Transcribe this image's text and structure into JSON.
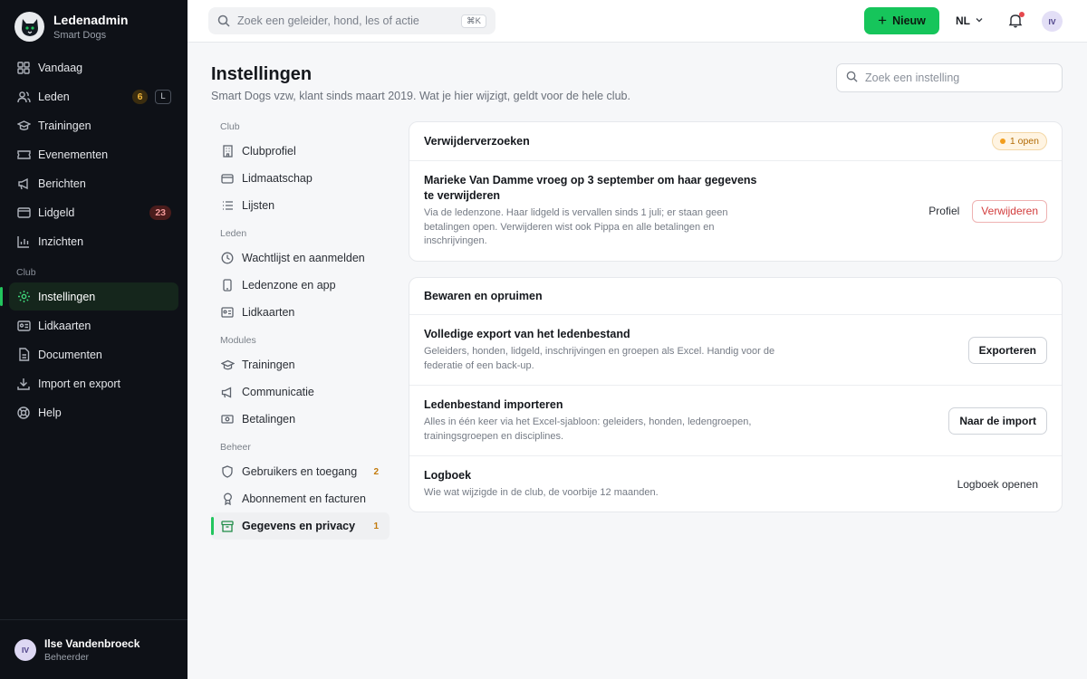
{
  "brand": {
    "title": "Ledenadmin",
    "subtitle": "Smart Dogs"
  },
  "sidebar": {
    "items": [
      {
        "label": "Vandaag",
        "icon": "grid-icon"
      },
      {
        "label": "Leden",
        "icon": "users-icon",
        "badge": "6",
        "shortcut": "L"
      },
      {
        "label": "Trainingen",
        "icon": "graduation-cap-icon"
      },
      {
        "label": "Evenementen",
        "icon": "ticket-icon"
      },
      {
        "label": "Berichten",
        "icon": "megaphone-icon"
      },
      {
        "label": "Lidgeld",
        "icon": "wallet-icon",
        "badge": "23"
      },
      {
        "label": "Inzichten",
        "icon": "bar-chart-icon"
      }
    ],
    "section_club": "Club",
    "club_items": [
      {
        "label": "Instellingen",
        "icon": "gear-icon",
        "active": true
      },
      {
        "label": "Lidkaarten",
        "icon": "id-card-icon"
      },
      {
        "label": "Documenten",
        "icon": "document-icon"
      },
      {
        "label": "Import en export",
        "icon": "download-icon"
      },
      {
        "label": "Help",
        "icon": "lifebuoy-icon"
      }
    ]
  },
  "user": {
    "initials": "IV",
    "name": "Ilse Vandenbroeck",
    "role": "Beheerder"
  },
  "topbar": {
    "search_placeholder": "Zoek een geleider, hond, les of actie",
    "search_shortcut": "⌘K",
    "new_label": "Nieuw",
    "lang": "NL",
    "avatar": "IV"
  },
  "page": {
    "title": "Instellingen",
    "subtitle": "Smart Dogs vzw, klant sinds maart 2019. Wat je hier wijzigt, geldt voor de hele club.",
    "search_placeholder": "Zoek een instelling"
  },
  "settings_nav": {
    "sections": [
      {
        "label": "Club",
        "items": [
          {
            "label": "Clubprofiel",
            "icon": "building-icon"
          },
          {
            "label": "Lidmaatschap",
            "icon": "wallet-icon"
          },
          {
            "label": "Lijsten",
            "icon": "list-icon"
          }
        ]
      },
      {
        "label": "Leden",
        "items": [
          {
            "label": "Wachtlijst en aanmelden",
            "icon": "clock-icon"
          },
          {
            "label": "Ledenzone en app",
            "icon": "phone-icon"
          },
          {
            "label": "Lidkaarten",
            "icon": "id-card-icon"
          }
        ]
      },
      {
        "label": "Modules",
        "items": [
          {
            "label": "Trainingen",
            "icon": "graduation-cap-icon"
          },
          {
            "label": "Communicatie",
            "icon": "megaphone-icon"
          },
          {
            "label": "Betalingen",
            "icon": "cash-icon"
          }
        ]
      },
      {
        "label": "Beheer",
        "items": [
          {
            "label": "Gebruikers en toegang",
            "icon": "shield-icon",
            "badge": "2"
          },
          {
            "label": "Abonnement en facturen",
            "icon": "award-icon"
          },
          {
            "label": "Gegevens en privacy",
            "icon": "archive-icon",
            "badge": "1",
            "active": true
          }
        ]
      }
    ]
  },
  "deletion_card": {
    "title": "Verwijderverzoeken",
    "pill": "1 open",
    "request": {
      "title": "Marieke Van Damme vroeg op 3 september om haar gegevens te verwijderen",
      "desc": "Via de ledenzone. Haar lidgeld is vervallen sinds 1 juli; er staan geen betalingen open. Verwijderen wist ook Pippa en alle betalingen en inschrijvingen.",
      "profile_label": "Profiel",
      "delete_label": "Verwijderen"
    }
  },
  "retention_card": {
    "title": "Bewaren en opruimen",
    "rows": [
      {
        "title": "Volledige export van het ledenbestand",
        "desc": "Geleiders, honden, lidgeld, inschrijvingen en groepen als Excel. Handig voor de federatie of een back-up.",
        "action": "Exporteren"
      },
      {
        "title": "Ledenbestand importeren",
        "desc": "Alles in één keer via het Excel-sjabloon: geleiders, honden, ledengroepen, trainingsgroepen en disciplines.",
        "action": "Naar de import"
      },
      {
        "title": "Logboek",
        "desc": "Wie wat wijzigde in de club, de voorbije 12 maanden.",
        "action": "Logboek openen"
      }
    ]
  },
  "colors": {
    "accent": "#22c55e",
    "sidebar_bg": "#0e1117",
    "danger": "#d23c3c",
    "warning": "#f29d1c"
  }
}
